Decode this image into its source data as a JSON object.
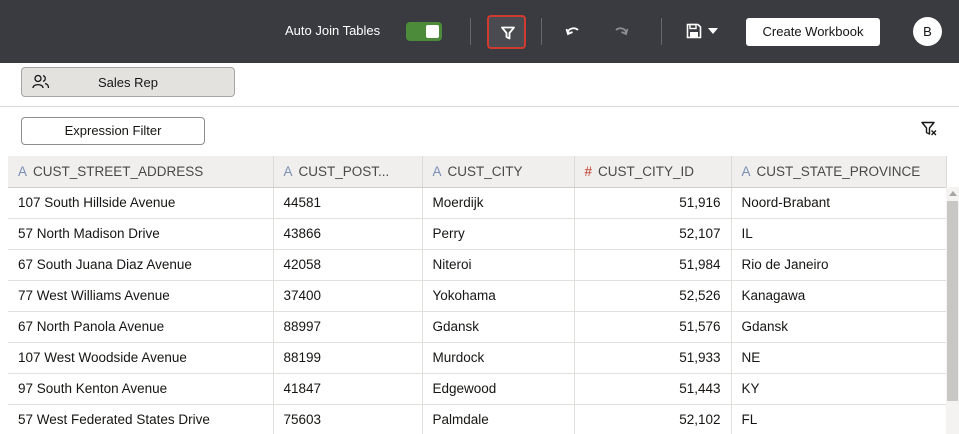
{
  "toolbar": {
    "auto_join_label": "Auto Join Tables",
    "auto_join_on": true,
    "create_workbook_label": "Create Workbook",
    "avatar_initial": "B",
    "icons": [
      "filter-icon",
      "undo-icon",
      "redo-icon",
      "save-icon",
      "dropdown-caret-icon"
    ],
    "colors": {
      "bar": "#3a3b40",
      "toggle_on": "#4c8b3a",
      "highlight": "#d13a2f"
    }
  },
  "filters": {
    "sales_rep_label": "Sales Rep",
    "expression_filter_label": "Expression Filter"
  },
  "table": {
    "columns": [
      {
        "type": "A",
        "label": "CUST_STREET_ADDRESS"
      },
      {
        "type": "A",
        "label": "CUST_POST..."
      },
      {
        "type": "A",
        "label": "CUST_CITY"
      },
      {
        "type": "#",
        "label": "CUST_CITY_ID"
      },
      {
        "type": "A",
        "label": "CUST_STATE_PROVINCE"
      }
    ],
    "rows": [
      [
        "107 South Hillside Avenue",
        "44581",
        "Moerdijk",
        "51,916",
        "Noord-Brabant"
      ],
      [
        "57 North Madison Drive",
        "43866",
        "Perry",
        "52,107",
        "IL"
      ],
      [
        "67 South Juana Diaz Avenue",
        "42058",
        "Niteroi",
        "51,984",
        "Rio de Janeiro"
      ],
      [
        "77 West Williams Avenue",
        "37400",
        "Yokohama",
        "52,526",
        "Kanagawa"
      ],
      [
        "67 North Panola Avenue",
        "88997",
        "Gdansk",
        "51,576",
        "Gdansk"
      ],
      [
        "107 West Woodside Avenue",
        "88199",
        "Murdock",
        "51,933",
        "NE"
      ],
      [
        "97 South Kenton Avenue",
        "41847",
        "Edgewood",
        "51,443",
        "KY"
      ],
      [
        "57 West Federated States Drive",
        "75603",
        "Palmdale",
        "52,102",
        "FL"
      ]
    ]
  }
}
